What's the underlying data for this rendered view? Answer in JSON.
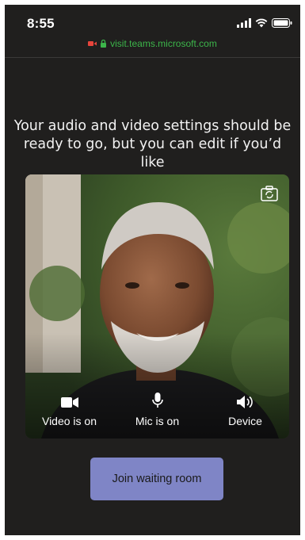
{
  "status_bar": {
    "time": "8:55"
  },
  "browser": {
    "url": "visit.teams.microsoft.com"
  },
  "prompt": {
    "text": "Your audio and video settings should be ready to go, but you can edit if you’d like"
  },
  "controls": [
    {
      "label": "Video is on",
      "icon": "video-camera-icon"
    },
    {
      "label": "Mic is on",
      "icon": "microphone-icon"
    },
    {
      "label": "Device",
      "icon": "speaker-icon"
    }
  ],
  "join_button": {
    "label": "Join waiting room"
  },
  "colors": {
    "background": "#201f1e",
    "accent": "#7f85c6",
    "secure": "#3cb54a",
    "recording": "#e8453c"
  }
}
